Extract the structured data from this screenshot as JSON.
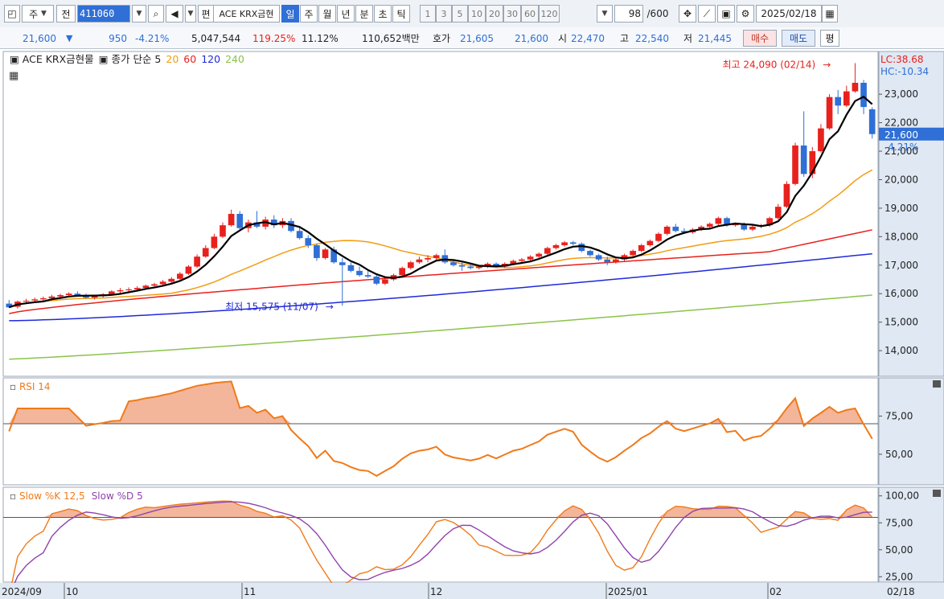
{
  "toolbar": {
    "mode_label": "주",
    "prev_label": "전",
    "stock_code": "411060",
    "edit_label": "편",
    "stock_name": "ACE KRX금현",
    "periods": [
      "일",
      "주",
      "월",
      "년",
      "분",
      "초",
      "틱"
    ],
    "active_period": "일",
    "multipliers": [
      "1",
      "3",
      "5",
      "10",
      "20",
      "30",
      "60",
      "120"
    ],
    "count_value": "98",
    "count_total": "/600",
    "date_value": "2025/02/18"
  },
  "quote": {
    "price": "21,600",
    "down_arrow": "▼",
    "change": "950",
    "change_pct": "-4.21%",
    "volume": "5,047,544",
    "vol_ratio": "119.25%",
    "turnover": "11.12%",
    "amount": "110,652백만",
    "hoga_label": "호가",
    "ask": "21,605",
    "bid": "21,600",
    "open_label": "시",
    "open": "22,470",
    "high_label": "고",
    "high": "22,540",
    "low_label": "저",
    "low": "21,445",
    "buy_label": "매수",
    "sell_label": "매도",
    "eval_label": "평"
  },
  "price_panel": {
    "title": "ACE KRX금현물",
    "ma_label": "종가 단순 5",
    "ma_periods": [
      "20",
      "60",
      "120",
      "240"
    ],
    "high_annotation": "최고 24,090 (02/14)",
    "low_annotation": "최저 15,575 (11/07)",
    "lc": "LC:38.68",
    "hc": "HC:-10.34",
    "current_price": "21,600",
    "current_change": "-4.21%"
  },
  "rsi_panel": {
    "title": "RSI 14"
  },
  "stoch_panel": {
    "title_k": "Slow %K 12,5",
    "title_d": "Slow %D 5"
  },
  "colors": {
    "up": "#e8211d",
    "down": "#2f6fd6",
    "ma5": "#000000",
    "ma20": "#f39c12",
    "ma60": "#e8211d",
    "ma120": "#1f2ad8",
    "ma240": "#8bc34a",
    "rsi": "#f07a1a",
    "stoch_k": "#f07a1a",
    "stoch_d": "#8e44ad"
  },
  "chart_data": [
    {
      "type": "line",
      "panel": "price",
      "yticks": [
        14000,
        15000,
        16000,
        17000,
        18000,
        19000,
        20000,
        21000,
        22000,
        23000
      ],
      "yticklabels": [
        "14,000",
        "15,000",
        "16,000",
        "17,000",
        "18,000",
        "19,000",
        "20,000",
        "21,000",
        "22,000",
        "23,000"
      ],
      "ylim": [
        13100,
        24500
      ],
      "x_labels": [
        "2024/09",
        "10",
        "11",
        "12",
        "2025/01",
        "02",
        "02/18"
      ],
      "candles": [
        [
          15650,
          15780,
          15500,
          15520
        ],
        [
          15540,
          15760,
          15480,
          15720
        ],
        [
          15720,
          15820,
          15640,
          15750
        ],
        [
          15760,
          15860,
          15700,
          15800
        ],
        [
          15800,
          15900,
          15720,
          15840
        ],
        [
          15840,
          15960,
          15760,
          15900
        ],
        [
          15900,
          16000,
          15840,
          15950
        ],
        [
          15950,
          16050,
          15880,
          16000
        ],
        [
          16000,
          16080,
          15900,
          15940
        ],
        [
          15940,
          16000,
          15820,
          15860
        ],
        [
          15860,
          15960,
          15800,
          15920
        ],
        [
          15920,
          16020,
          15860,
          15980
        ],
        [
          15980,
          16120,
          15940,
          16080
        ],
        [
          16080,
          16200,
          16020,
          16120
        ],
        [
          16120,
          16220,
          16080,
          16150
        ],
        [
          16150,
          16260,
          16100,
          16200
        ],
        [
          16200,
          16320,
          16150,
          16280
        ],
        [
          16280,
          16380,
          16220,
          16330
        ],
        [
          16330,
          16480,
          16280,
          16420
        ],
        [
          16420,
          16580,
          16360,
          16520
        ],
        [
          16520,
          16760,
          16480,
          16700
        ],
        [
          16700,
          17000,
          16660,
          16950
        ],
        [
          16950,
          17380,
          16900,
          17300
        ],
        [
          17300,
          17700,
          17260,
          17600
        ],
        [
          17600,
          18100,
          17560,
          18000
        ],
        [
          18000,
          18500,
          17950,
          18400
        ],
        [
          18400,
          18950,
          18350,
          18800
        ],
        [
          18800,
          18900,
          18200,
          18300
        ],
        [
          18300,
          18600,
          18150,
          18500
        ],
        [
          18500,
          18900,
          18300,
          18350
        ],
        [
          18350,
          18700,
          18250,
          18600
        ],
        [
          18600,
          18750,
          18300,
          18400
        ],
        [
          18400,
          18650,
          18300,
          18550
        ],
        [
          18550,
          18650,
          18150,
          18200
        ],
        [
          18200,
          18350,
          17900,
          17950
        ],
        [
          17950,
          18050,
          17600,
          17700
        ],
        [
          17700,
          17750,
          17150,
          17250
        ],
        [
          17250,
          17600,
          17200,
          17550
        ],
        [
          17550,
          17650,
          17050,
          17100
        ],
        [
          17100,
          17250,
          15575,
          17000
        ],
        [
          17000,
          17100,
          16750,
          16800
        ],
        [
          16800,
          16950,
          16600,
          16650
        ],
        [
          16650,
          16800,
          16550,
          16600
        ],
        [
          16600,
          16650,
          16300,
          16350
        ],
        [
          16350,
          16550,
          16300,
          16500
        ],
        [
          16500,
          16700,
          16450,
          16650
        ],
        [
          16650,
          16950,
          16600,
          16900
        ],
        [
          16900,
          17150,
          16850,
          17100
        ],
        [
          17100,
          17300,
          17050,
          17200
        ],
        [
          17200,
          17350,
          17100,
          17250
        ],
        [
          17250,
          17400,
          17150,
          17350
        ],
        [
          17350,
          17550,
          17050,
          17100
        ],
        [
          17100,
          17200,
          16950,
          17000
        ],
        [
          17000,
          17100,
          16800,
          16950
        ],
        [
          16950,
          17050,
          16850,
          16900
        ],
        [
          16900,
          17000,
          16850,
          16950
        ],
        [
          16950,
          17100,
          16900,
          17050
        ],
        [
          17050,
          17100,
          16900,
          16950
        ],
        [
          16950,
          17100,
          16900,
          17050
        ],
        [
          17050,
          17200,
          17000,
          17150
        ],
        [
          17150,
          17250,
          17050,
          17200
        ],
        [
          17200,
          17350,
          17150,
          17300
        ],
        [
          17300,
          17450,
          17250,
          17400
        ],
        [
          17400,
          17650,
          17350,
          17600
        ],
        [
          17600,
          17750,
          17550,
          17700
        ],
        [
          17700,
          17850,
          17650,
          17800
        ],
        [
          17800,
          17850,
          17700,
          17750
        ],
        [
          17750,
          17800,
          17450,
          17500
        ],
        [
          17500,
          17550,
          17300,
          17350
        ],
        [
          17350,
          17400,
          17150,
          17200
        ],
        [
          17200,
          17300,
          17000,
          17100
        ],
        [
          17100,
          17250,
          17050,
          17200
        ],
        [
          17200,
          17400,
          17150,
          17350
        ],
        [
          17350,
          17550,
          17300,
          17500
        ],
        [
          17500,
          17750,
          17450,
          17700
        ],
        [
          17700,
          17900,
          17650,
          17850
        ],
        [
          17850,
          18150,
          17800,
          18100
        ],
        [
          18100,
          18400,
          18050,
          18350
        ],
        [
          18350,
          18450,
          18150,
          18200
        ],
        [
          18200,
          18300,
          18100,
          18150
        ],
        [
          18150,
          18300,
          18100,
          18250
        ],
        [
          18250,
          18400,
          18200,
          18350
        ],
        [
          18350,
          18500,
          18300,
          18450
        ],
        [
          18450,
          18700,
          18400,
          18650
        ],
        [
          18650,
          18700,
          18350,
          18400
        ],
        [
          18400,
          18500,
          18350,
          18450
        ],
        [
          18450,
          18500,
          18200,
          18250
        ],
        [
          18250,
          18400,
          18200,
          18350
        ],
        [
          18350,
          18450,
          18300,
          18400
        ],
        [
          18400,
          18700,
          18350,
          18650
        ],
        [
          18650,
          19150,
          18600,
          19050
        ],
        [
          19050,
          19950,
          19000,
          19850
        ],
        [
          19850,
          21300,
          19800,
          21200
        ],
        [
          21200,
          22400,
          20100,
          20200
        ],
        [
          20200,
          21150,
          20050,
          21000
        ],
        [
          21000,
          21950,
          20950,
          21800
        ],
        [
          21800,
          23000,
          21750,
          22900
        ],
        [
          22900,
          23150,
          22300,
          22600
        ],
        [
          22600,
          23300,
          22550,
          23100
        ],
        [
          23100,
          24090,
          23050,
          23400
        ],
        [
          23400,
          23500,
          22300,
          22550
        ],
        [
          22470,
          22540,
          21445,
          21600
        ]
      ]
    },
    {
      "type": "line",
      "panel": "rsi",
      "title": "RSI 14",
      "yticks": [
        50,
        75
      ],
      "yticklabels": [
        "50,00",
        "75,00"
      ],
      "ylim": [
        30,
        100
      ],
      "reference_line": 70
    },
    {
      "type": "area",
      "panel": "stochastic",
      "yticks": [
        25,
        50,
        75,
        100
      ],
      "yticklabels": [
        "25,00",
        "50,00",
        "75,00",
        "100,00"
      ],
      "ylim": [
        20,
        108
      ],
      "reference_line": 80
    }
  ]
}
